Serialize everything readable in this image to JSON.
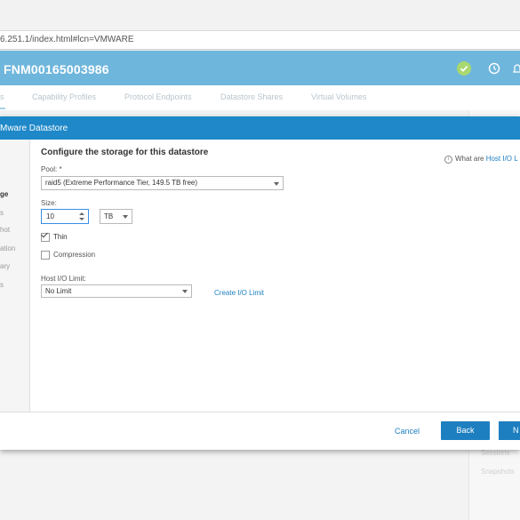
{
  "browser": {
    "address": "6.251.1/index.html#lcn=VMWARE"
  },
  "app": {
    "title": "FNM00165003986"
  },
  "tabs": [
    {
      "label": "s"
    },
    {
      "label": "Capability Profiles"
    },
    {
      "label": "Protocol Endpoints"
    },
    {
      "label": "Datastore Shares"
    },
    {
      "label": "Virtual Volumes"
    }
  ],
  "background_faded": [
    "Sessions",
    "Snapshots"
  ],
  "dialog": {
    "title": "Mware Datastore",
    "steps": [
      "ge",
      "s",
      "hot",
      "ation",
      "ary",
      "s"
    ],
    "section_title": "Configure the storage for this datastore",
    "help": {
      "prefix": "What are ",
      "link": "Host I/O L"
    },
    "pool": {
      "label": "Pool: *",
      "value": "raid5 (Extreme Performance Tier, 149.5 TB free)"
    },
    "size": {
      "label": "Size:",
      "value": "10",
      "unit": "TB"
    },
    "thin": {
      "label": "Thin",
      "checked": true
    },
    "compression": {
      "label": "Compression",
      "checked": false
    },
    "host_io": {
      "label": "Host I/O Limit:",
      "value": "No Limit",
      "create_link": "Create I/O Limit"
    },
    "buttons": {
      "cancel": "Cancel",
      "back": "Back",
      "next": "N"
    }
  },
  "colors": {
    "header": "#6fb6dc",
    "dialog_header": "#1e88c8",
    "primary_button": "#1e7fc0",
    "link": "#1e7fc0"
  }
}
